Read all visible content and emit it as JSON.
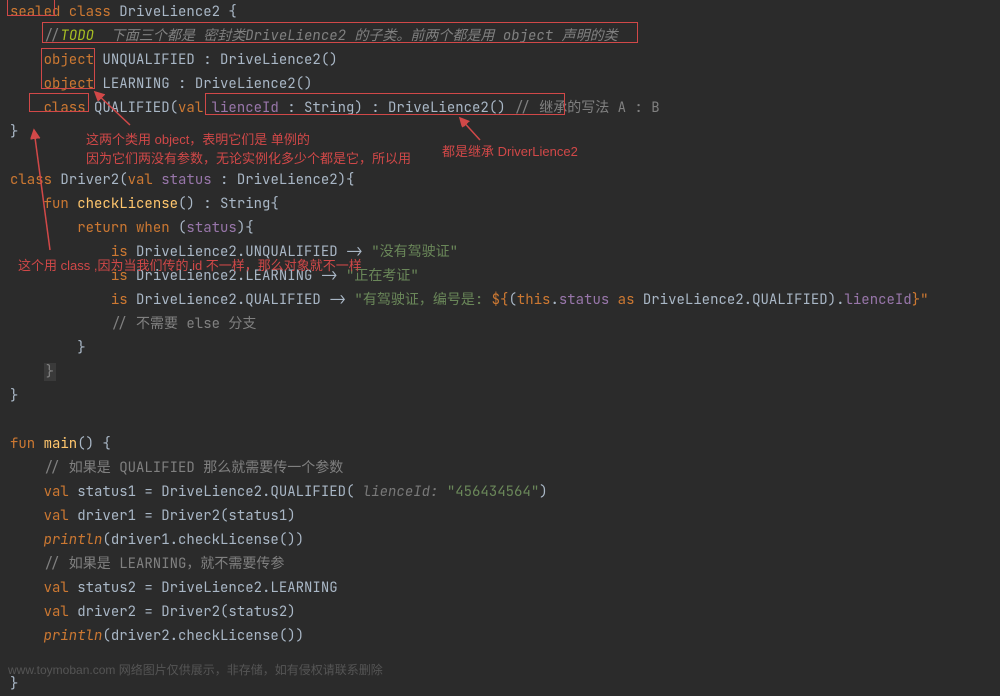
{
  "code": {
    "l1": {
      "sealed": "sealed",
      "class": " class ",
      "name": "DriveLience2",
      "brace": " {"
    },
    "l2": {
      "slash": "//",
      "todo": "TODO",
      "txt": "  下面三个都是 密封类DriveLience2 的子类。前两个都是用 object 声明的类"
    },
    "l3": {
      "obj": "object",
      "name": " UNQUALIFIED : DriveLience2()"
    },
    "l4": {
      "obj": "object",
      "name": " LEARNING : DriveLience2()"
    },
    "l5": {
      "cls": "class",
      "name": " QUALIFIED(",
      "val": "val ",
      "param": "lienceId",
      "rest": " : String) : DriveLience2() ",
      "cmt": "// 继承的写法 A : B"
    },
    "l6": {
      "brace": "}"
    },
    "l7": {
      "cls": "class ",
      "name": "Driver2",
      "open": "(",
      "val": "val ",
      "param": "status",
      "rest": " : DriveLience2){"
    },
    "l8": {
      "fun": "fun ",
      "fname": "checkLicense",
      "rest": "() : String{"
    },
    "l9": {
      "ret": "return ",
      "when": "when ",
      "open": "(",
      "stat": "status",
      "close": "){"
    },
    "l10": {
      "is": "is ",
      "type": "DriveLience2.UNQUALIFIED -> ",
      "str": "\"没有驾驶证\""
    },
    "l11": {
      "is": "is ",
      "type": "DriveLience2.LEARNING -> ",
      "str": "\"正在考证\""
    },
    "l12": {
      "is": "is ",
      "type": "DriveLience2.QUALIFIED -> ",
      "str1": "\"有驾驶证，编号是: ",
      "dl": "${",
      "open": "(",
      "this": "this",
      "dot1": ".",
      "status": "status",
      "as": " as ",
      "cast": "DriveLience2.QUALIFIED",
      "close": ")",
      "dot2": ".",
      "lid": "lienceId",
      "end": "}\""
    },
    "l13": {
      "cmt": "// 不需要 else 分支"
    },
    "l14": {
      "brace": "}"
    },
    "l15": {
      "brace": "}"
    },
    "l16": {
      "brace": "}"
    },
    "l17": {
      "fun": "fun ",
      "fname": "main",
      "rest": "() {"
    },
    "l18": {
      "cmt": "// 如果是 QUALIFIED 那么就需要传一个参数"
    },
    "l19": {
      "val": "val ",
      "name": "status1 = DriveLience2.QUALIFIED(",
      "hint": " lienceId: ",
      "str": "\"456434564\"",
      "end": ")"
    },
    "l20": {
      "val": "val ",
      "name": "driver1 = Driver2(status1)"
    },
    "l21": {
      "fn": "println",
      "rest": "(driver1.checkLicense())"
    },
    "l22": {
      "cmt": "// 如果是 LEARNING，就不需要传参"
    },
    "l23": {
      "val": "val ",
      "name": "status2 = DriveLience2.LEARNING"
    },
    "l24": {
      "val": "val ",
      "name": "driver2 = Driver2(status2)"
    },
    "l25": {
      "fn": "println",
      "rest": "(driver2.checkLicense())"
    },
    "l26": {
      "brace": "}"
    }
  },
  "annotations": {
    "a1": "这两个类用 object，表明它们是 单例的",
    "a2": "因为它们两没有参数，无论实例化多少个都是它，所以用",
    "a3": "都是继承 DriverLience2",
    "a4": "这个用 class ,因为当我们传的 id 不一样，那么对象就不一样"
  },
  "watermark": "www.toymoban.com 网络图片仅供展示，非存储，如有侵权请联系删除"
}
